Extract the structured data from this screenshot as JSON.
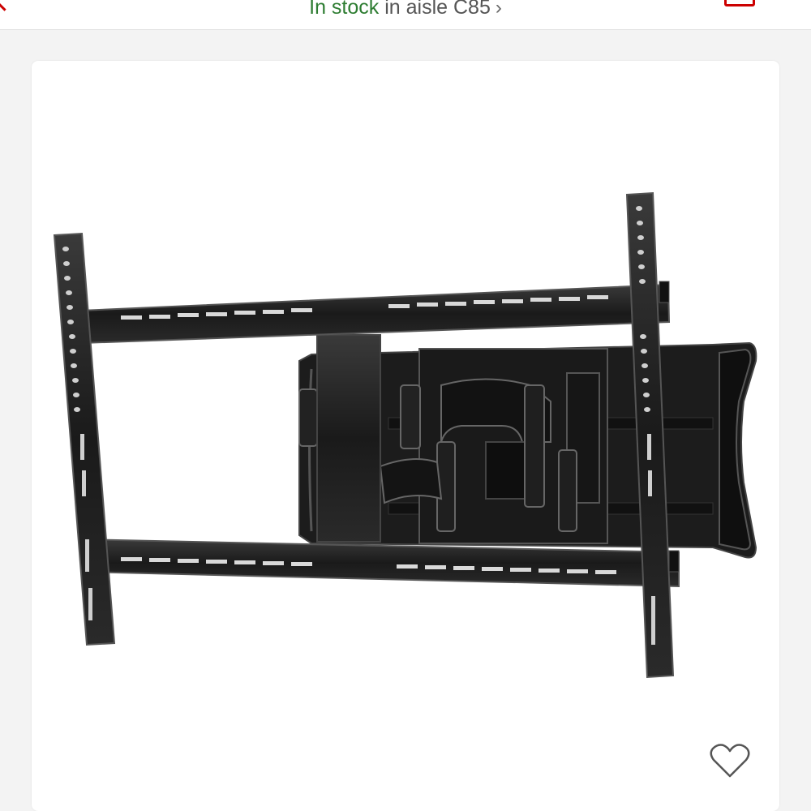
{
  "header": {
    "stock_status": "In stock",
    "aisle_text": "in aisle C85",
    "aisle_chevron": "›"
  },
  "product": {
    "image_icon": "tv-wall-mount",
    "favorite_icon": "heart-outline-icon"
  },
  "colors": {
    "brand_red": "#cc0000",
    "in_stock_green": "#2e7d32",
    "text_gray": "#555555"
  }
}
